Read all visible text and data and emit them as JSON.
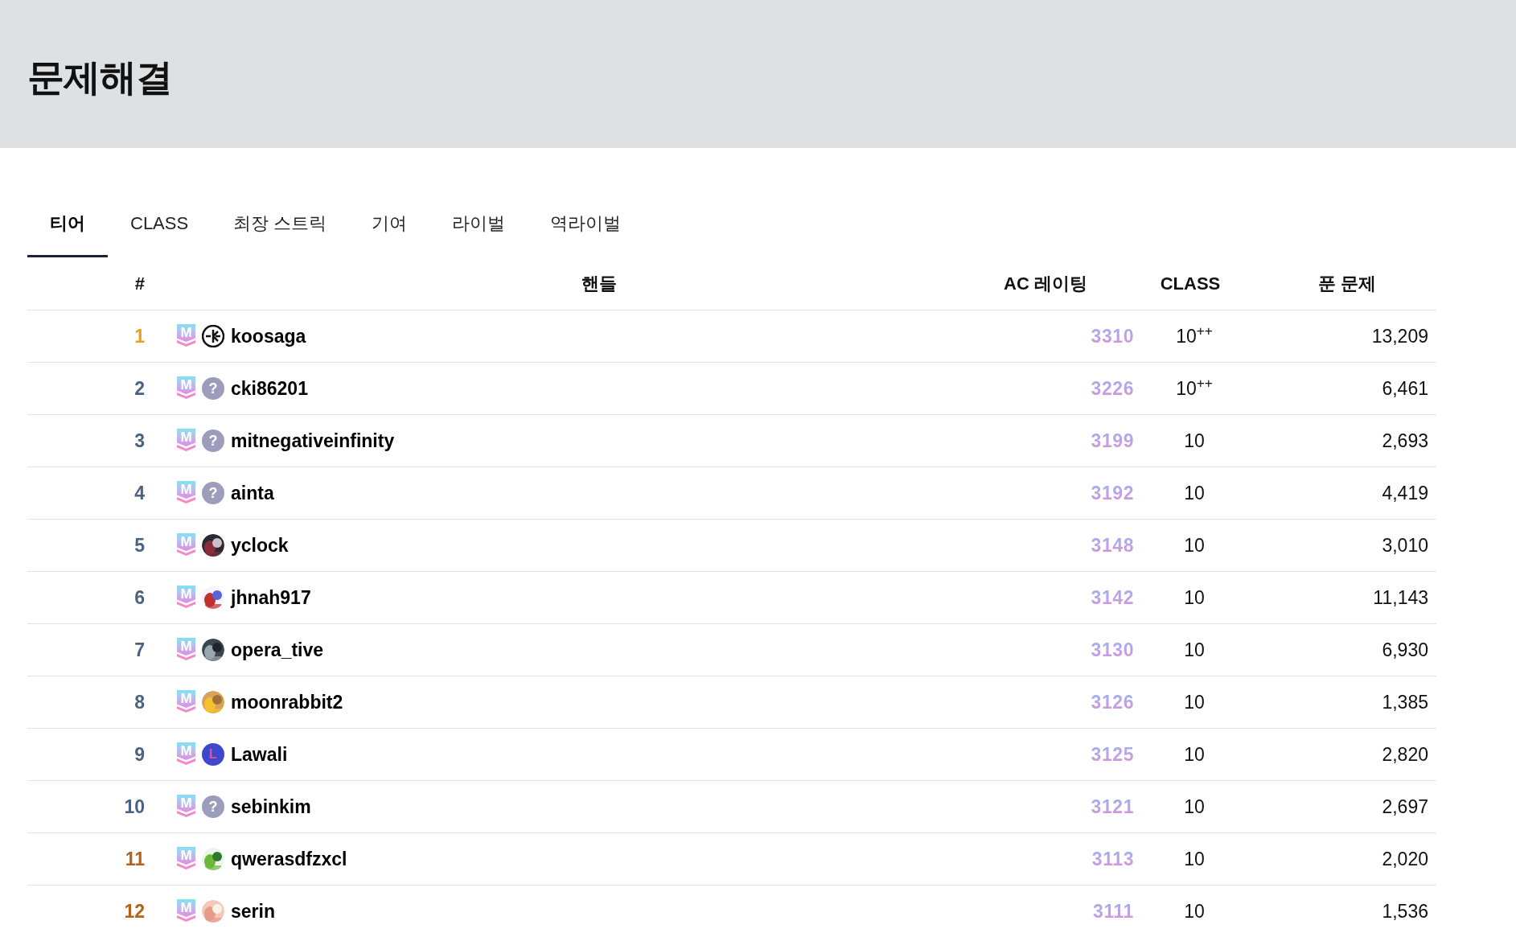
{
  "page_title": "문제해결",
  "tabs": [
    {
      "label": "티어",
      "selected": true
    },
    {
      "label": "CLASS",
      "selected": false
    },
    {
      "label": "최장 스트릭",
      "selected": false
    },
    {
      "label": "기여",
      "selected": false
    },
    {
      "label": "라이벌",
      "selected": false
    },
    {
      "label": "역라이벌",
      "selected": false
    }
  ],
  "table": {
    "columns": [
      "#",
      "핸들",
      "AC 레이팅",
      "CLASS",
      "푼 문제"
    ],
    "rows": [
      {
        "rank": "1",
        "color": "#e8a020",
        "tier": "M",
        "avatar": {
          "kind": "logo"
        },
        "handle": "koosaga",
        "rating": "3310",
        "class": "10$^{++}$",
        "solved": "13,209"
      },
      {
        "rank": "2",
        "color": "#4a6382",
        "tier": "M",
        "avatar": {
          "kind": "unknown",
          "mark": "?"
        },
        "handle": "cki86201",
        "rating": "3226",
        "class": "10$^{++}$",
        "solved": "6,461"
      },
      {
        "rank": "3",
        "color": "#4a6382",
        "tier": "M",
        "avatar": {
          "kind": "unknown",
          "mark": "?"
        },
        "handle": "mitnegativeinfinity",
        "rating": "3199",
        "class": "10",
        "solved": "2,693"
      },
      {
        "rank": "4",
        "color": "#4a6382",
        "tier": "M",
        "avatar": {
          "kind": "unknown",
          "mark": "?"
        },
        "handle": "ainta",
        "rating": "3192",
        "class": "10",
        "solved": "4,419"
      },
      {
        "rank": "5",
        "color": "#4a6382",
        "tier": "M",
        "handle": "yclock",
        "rating": "3148",
        "class": "10",
        "solved": "3,010"
      },
      {
        "rank": "6",
        "color": "#4a6382",
        "tier": "M",
        "handle": "jhnah917",
        "rating": "3142",
        "class": "10",
        "solved": "11,143"
      },
      {
        "rank": "7",
        "color": "#4a6382",
        "tier": "M",
        "handle": "opera_tive",
        "rating": "3130",
        "class": "10",
        "solved": "6,930"
      },
      {
        "rank": "8",
        "color": "#4a6382",
        "tier": "M",
        "handle": "moonrabbit2",
        "rating": "3126",
        "class": "10",
        "solved": "1,385"
      },
      {
        "rank": "9",
        "color": "#4a6382",
        "tier": "M",
        "avatar": {
          "kind": "letter",
          "letter": "L"
        },
        "handle": "Lawali",
        "rating": "3125",
        "class": "10",
        "solved": "2,820"
      },
      {
        "rank": "10",
        "color": "#4a6382",
        "tier": "M",
        "avatar": {
          "kind": "unknown",
          "mark": "?"
        },
        "handle": "sebinkim",
        "rating": "3121",
        "class": "10",
        "solved": "2,697"
      },
      {
        "rank": "11",
        "color": "#b5621a",
        "tier": "M",
        "handle": "qwerasdfzxcl",
        "rating": "3113",
        "class": "10",
        "solved": "2,020"
      },
      {
        "rank": "12",
        "color": "#b5621a",
        "tier": "M",
        "handle": "serin",
        "rating": "3111",
        "class": "10",
        "solved": "1,536"
      }
    ]
  }
}
